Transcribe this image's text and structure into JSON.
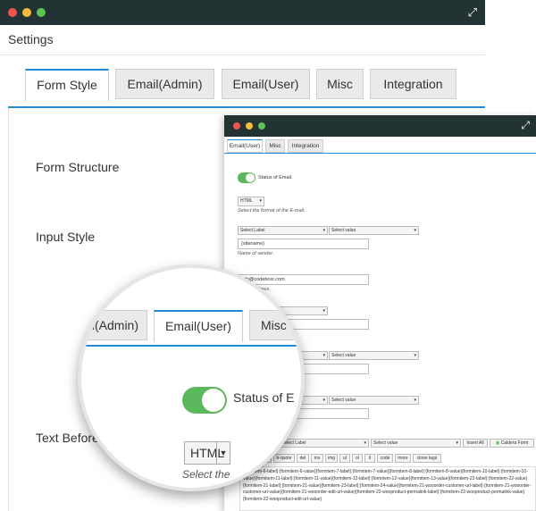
{
  "main": {
    "title": "Settings",
    "tabs": [
      "Form Style",
      "Email(Admin)",
      "Email(User)",
      "Misc",
      "Integration"
    ],
    "labels": {
      "form_structure": "Form Structure",
      "input_style": "Input Style",
      "text_before": "Text Before"
    }
  },
  "small": {
    "tabs": [
      "Email(User)",
      "Misc",
      "Integration"
    ],
    "status_label": "Status of Email.",
    "format_value": "HTML",
    "format_hint": "Select the format of the E-mail.",
    "select_label": "Select Label",
    "select_value": "Select value",
    "sender_name_value": "{sitename}",
    "sender_name_hint": "Name of sender.",
    "email_value": "info@codeboxr.com",
    "email_hint": "Email Address.",
    "field_value_1": "{formitem-6-value}",
    "field_value_2": "{formitem-6-value}",
    "editor_buttons": [
      "b",
      "i",
      "link",
      "b-quote",
      "del",
      "ins",
      "img",
      "ul",
      "ol",
      "li",
      "code",
      "more",
      "close tags"
    ],
    "insert_all": "Insert All",
    "caldera_form": "Caldera Form",
    "body_text": "{formitem-6-label}:{formitem-6-value}{formitem-7-label}:{formitem-7-value}{formitem-8-label}:{formitem-8-value}{formitem-10-label}:{formitem-10-value}{formitem-11-label}:{formitem-11-value}{formitem-12-label}:{formitem-12-value}{formitem-13-value}{formitem-22-label}:{formitem-22-value}{formitem-21-label}:{formitem-21-value}{formitem-23-label}:{formitem-24-value}{formitem-21-wooorder-customer-url-label}:{formitem-21-wooorder-customer-url-value}{formitem-21-wooorder-edit-url-value}{formitem-22-wooproduct-permalink-label}:{formitem-22-wooproduct-permalink-value}{formitem-22-wooproduct-edit-url-value}"
  },
  "magnifier": {
    "tabs": [
      "Email(Admin)",
      "Email(User)",
      "Misc"
    ],
    "status_label": "Status of E",
    "format_value": "HTML",
    "format_hint": "Select the"
  }
}
